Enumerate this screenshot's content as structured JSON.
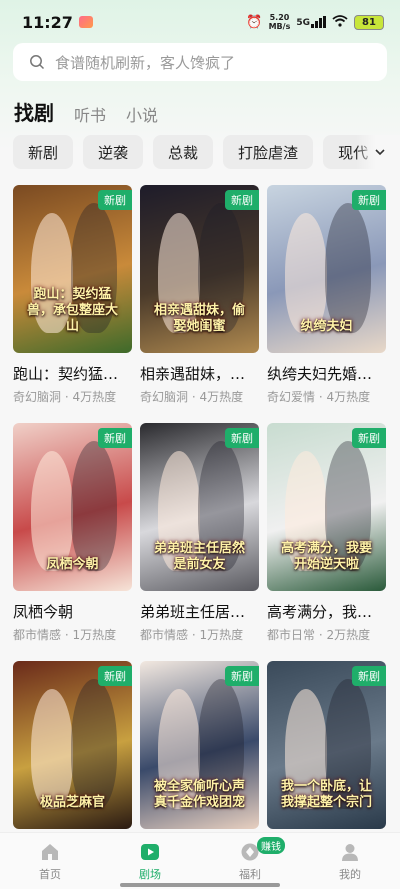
{
  "status": {
    "time": "11:27",
    "speed_value": "5.20",
    "speed_unit": "MB/s",
    "network": "5G",
    "battery": "81"
  },
  "search": {
    "placeholder": "食谱随机刷新，客人馋疯了"
  },
  "top_tabs": [
    "找剧",
    "听书",
    "小说"
  ],
  "chips": [
    "新剧",
    "逆袭",
    "总裁",
    "打脸虐渣",
    "现代"
  ],
  "badge_label": "新剧",
  "cards": [
    {
      "title": "跑山：契约猛…",
      "meta": "奇幻脑洞 · 4万热度",
      "poster_text": "跑山：契约猛兽，承包整座大山",
      "colors": [
        "#7a4a22",
        "#c98a3a",
        "#3d6a2a"
      ]
    },
    {
      "title": "相亲遇甜妹，…",
      "meta": "奇幻脑洞 · 4万热度",
      "poster_text": "相亲遇甜妹，偷娶她闺蜜",
      "colors": [
        "#1e1c2a",
        "#4a3a2a",
        "#b08a50"
      ]
    },
    {
      "title": "纨绔夫妇先婚…",
      "meta": "奇幻爱情 · 4万热度",
      "poster_text": "纨绔夫妇",
      "colors": [
        "#c8d4e0",
        "#8a98b8",
        "#e8d8c8"
      ]
    },
    {
      "title": "凤栖今朝",
      "meta": "都市情感 · 1万热度",
      "poster_text": "凤栖今朝",
      "colors": [
        "#f0d0c8",
        "#c84a4a",
        "#f6e4d8"
      ]
    },
    {
      "title": "弟弟班主任居…",
      "meta": "都市情感 · 1万热度",
      "poster_text": "弟弟班主任居然是前女友",
      "colors": [
        "#2a2a2e",
        "#d8d8dc",
        "#5a5a60"
      ]
    },
    {
      "title": "高考满分，我…",
      "meta": "都市日常 · 2万热度",
      "poster_text": "高考满分，我要开始逆天啦",
      "colors": [
        "#c8dcd0",
        "#f0f0f0",
        "#2a5a3a"
      ]
    },
    {
      "title": "",
      "meta": "",
      "poster_text": "极品芝麻官",
      "colors": [
        "#6a2a1a",
        "#c8a040",
        "#2a1a12"
      ]
    },
    {
      "title": "",
      "meta": "",
      "poster_text": "被全家偷听心声 真千金作戏团宠",
      "colors": [
        "#f2e8e0",
        "#3a4a6a",
        "#e8d0c0"
      ]
    },
    {
      "title": "",
      "meta": "",
      "poster_text": "我一个卧底，让我撑起整个宗门",
      "colors": [
        "#3a4a5a",
        "#6a7a8a",
        "#2a3a4a"
      ]
    }
  ],
  "bottom_nav": [
    {
      "label": "首页",
      "icon": "home-icon"
    },
    {
      "label": "剧场",
      "icon": "play-icon"
    },
    {
      "label": "福利",
      "icon": "welfare-icon"
    },
    {
      "label": "我的",
      "icon": "profile-icon"
    }
  ],
  "earn_badge": "赚钱",
  "colors": {
    "accent": "#1fae6a",
    "chip_bg": "#ececec"
  }
}
